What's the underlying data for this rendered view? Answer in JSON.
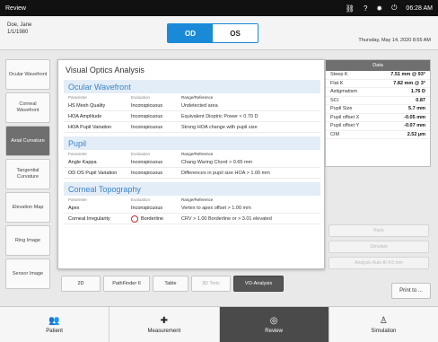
{
  "statusbar": {
    "title": "Review",
    "time": "06:28 AM",
    "icons": [
      "link-off-icon",
      "help-icon",
      "settings-icon",
      "power-icon"
    ]
  },
  "header": {
    "patient_name": "Doe, Jane",
    "patient_dob": "1/1/1980",
    "eye_od": "OD",
    "eye_os": "OS",
    "date": "Thursday, May 14, 2020 8:55 AM"
  },
  "sidebar": {
    "items": [
      {
        "label": "Ocular Wavefront"
      },
      {
        "label": "Corneal Wavefront"
      },
      {
        "label": "Axial Curvature"
      },
      {
        "label": "Tangential Curvature"
      },
      {
        "label": "Elevation Map"
      },
      {
        "label": "Ring Image"
      },
      {
        "label": "Sensor Image"
      }
    ]
  },
  "modal": {
    "title": "Visual Optics Analysis",
    "col_parameter": "Parameter",
    "col_evaluation": "Evaluation",
    "col_range": "Range/Reference",
    "sections": [
      {
        "title": "Ocular Wavefront",
        "rows": [
          {
            "param": "HS Mesh Quality",
            "eval": "Inconspicuous",
            "range": "Undetected area"
          },
          {
            "param": "HOA Amplitude",
            "eval": "Inconspicuous",
            "range": "Equivalent Dioptric Power < 0.70 D"
          },
          {
            "param": "HOA Pupil Variation",
            "eval": "Inconspicuous",
            "range": "Strong HOA change with pupil size"
          }
        ]
      },
      {
        "title": "Pupil",
        "rows": [
          {
            "param": "Angle Kappa",
            "eval": "Inconspicuous",
            "range": "Chang Waring Chord > 0.65 mm"
          },
          {
            "param": "OD OS Pupil Variation",
            "eval": "Inconspicuous",
            "range": "Differences in pupil size HOA > 1.00 mm"
          }
        ]
      },
      {
        "title": "Corneal Topography",
        "rows": [
          {
            "param": "Apex",
            "eval": "Inconspicuous",
            "range": "Vertex to apex offset > 1.00 mm"
          },
          {
            "param": "Corneal Irregularity",
            "eval": "Borderline",
            "range": "CRV > 1.00 Borderline or > 3.01 elevated"
          }
        ]
      }
    ]
  },
  "viewbuttons": {
    "b2d": "2D",
    "pathfinder": "PathFinder II",
    "table": "Table",
    "toric": "3D Toric",
    "vo": "VO-Analysis"
  },
  "datapanel": {
    "title": "Data",
    "rows": [
      {
        "label": "Steep K",
        "value": "7.51 mm @ 93°"
      },
      {
        "label": "Flat K",
        "value": "7.82 mm @ 3°"
      },
      {
        "label": "Astigmatism",
        "value": "1.76 D"
      },
      {
        "label": "SCI",
        "value": "0.87"
      },
      {
        "label": "Pupil Size",
        "value": "5.7 mm"
      },
      {
        "label": "Pupil offset X",
        "value": "-0.05 mm"
      },
      {
        "label": "Pupil offset Y",
        "value": "-0.07 mm"
      },
      {
        "label": "CIM",
        "value": "2.52 µm"
      }
    ]
  },
  "rightbuttons": {
    "b1": "Rank",
    "b2": "Simulate",
    "b3": "Analysis Auto-fit 4.5 mm",
    "print": "Print to ..."
  },
  "bottomnav": [
    {
      "label": "Patient",
      "icon": "patient-icon"
    },
    {
      "label": "Measurement",
      "icon": "measurement-icon"
    },
    {
      "label": "Review",
      "icon": "review-icon"
    },
    {
      "label": "Simulation",
      "icon": "simulation-icon"
    }
  ],
  "colors": {
    "accent": "#1a8ad8",
    "section_text": "#3a84c8",
    "section_bg": "#e3edf7",
    "active_gray": "#6f6f6f",
    "borderline": "#d12a2a"
  }
}
